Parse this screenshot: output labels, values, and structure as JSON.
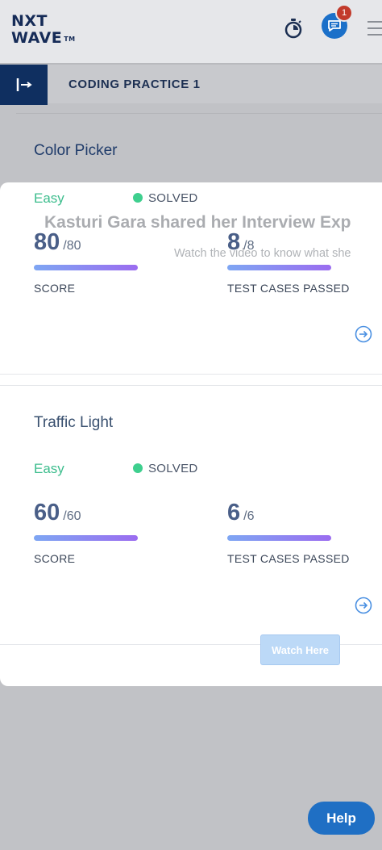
{
  "header": {
    "logo_line1": "NXT",
    "logo_line2": "WAVE",
    "logo_tm": "TM",
    "notification_count": "1"
  },
  "subheader": {
    "title": "CODING PRACTICE 1"
  },
  "problems": [
    {
      "title": "Color Picker",
      "difficulty": "Easy",
      "status": "SOLVED",
      "score": "80",
      "score_total": "/80",
      "score_label": "SCORE",
      "tests_passed": "8",
      "tests_total": "/8",
      "tests_label": "TEST CASES PASSED"
    },
    {
      "title": "Traffic Light",
      "difficulty": "Easy",
      "status": "SOLVED",
      "score": "60",
      "score_total": "/60",
      "score_label": "SCORE",
      "tests_passed": "6",
      "tests_total": "/6",
      "tests_label": "TEST CASES PASSED"
    }
  ],
  "overlay": {
    "title": "Kasturi Gara shared her Interview Exp",
    "subtitle": "Watch the video to know what she",
    "button": "Watch Here"
  },
  "help": {
    "label": "Help"
  },
  "colors": {
    "brand_navy": "#0f2f60",
    "easy_green": "#3dbd8d",
    "solved_dot": "#3ecf8e",
    "help_blue": "#1f6fc4",
    "badge_red": "#c23a2b"
  },
  "icons": [
    "timer-icon",
    "chat-icon",
    "menu-icon",
    "collapse-sidebar-icon",
    "arrow-right-circle-icon"
  ]
}
